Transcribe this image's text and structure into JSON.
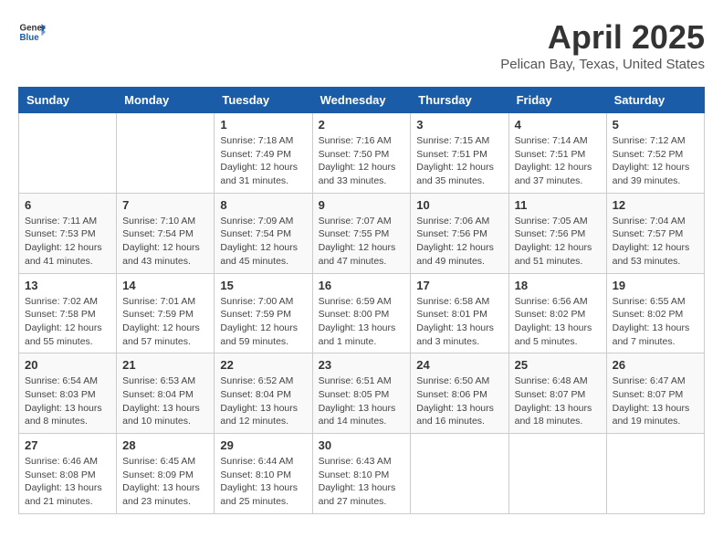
{
  "header": {
    "logo_general": "General",
    "logo_blue": "Blue",
    "title": "April 2025",
    "subtitle": "Pelican Bay, Texas, United States"
  },
  "columns": [
    "Sunday",
    "Monday",
    "Tuesday",
    "Wednesday",
    "Thursday",
    "Friday",
    "Saturday"
  ],
  "weeks": [
    [
      {
        "day": "",
        "info": ""
      },
      {
        "day": "",
        "info": ""
      },
      {
        "day": "1",
        "info": "Sunrise: 7:18 AM\nSunset: 7:49 PM\nDaylight: 12 hours and 31 minutes."
      },
      {
        "day": "2",
        "info": "Sunrise: 7:16 AM\nSunset: 7:50 PM\nDaylight: 12 hours and 33 minutes."
      },
      {
        "day": "3",
        "info": "Sunrise: 7:15 AM\nSunset: 7:51 PM\nDaylight: 12 hours and 35 minutes."
      },
      {
        "day": "4",
        "info": "Sunrise: 7:14 AM\nSunset: 7:51 PM\nDaylight: 12 hours and 37 minutes."
      },
      {
        "day": "5",
        "info": "Sunrise: 7:12 AM\nSunset: 7:52 PM\nDaylight: 12 hours and 39 minutes."
      }
    ],
    [
      {
        "day": "6",
        "info": "Sunrise: 7:11 AM\nSunset: 7:53 PM\nDaylight: 12 hours and 41 minutes."
      },
      {
        "day": "7",
        "info": "Sunrise: 7:10 AM\nSunset: 7:54 PM\nDaylight: 12 hours and 43 minutes."
      },
      {
        "day": "8",
        "info": "Sunrise: 7:09 AM\nSunset: 7:54 PM\nDaylight: 12 hours and 45 minutes."
      },
      {
        "day": "9",
        "info": "Sunrise: 7:07 AM\nSunset: 7:55 PM\nDaylight: 12 hours and 47 minutes."
      },
      {
        "day": "10",
        "info": "Sunrise: 7:06 AM\nSunset: 7:56 PM\nDaylight: 12 hours and 49 minutes."
      },
      {
        "day": "11",
        "info": "Sunrise: 7:05 AM\nSunset: 7:56 PM\nDaylight: 12 hours and 51 minutes."
      },
      {
        "day": "12",
        "info": "Sunrise: 7:04 AM\nSunset: 7:57 PM\nDaylight: 12 hours and 53 minutes."
      }
    ],
    [
      {
        "day": "13",
        "info": "Sunrise: 7:02 AM\nSunset: 7:58 PM\nDaylight: 12 hours and 55 minutes."
      },
      {
        "day": "14",
        "info": "Sunrise: 7:01 AM\nSunset: 7:59 PM\nDaylight: 12 hours and 57 minutes."
      },
      {
        "day": "15",
        "info": "Sunrise: 7:00 AM\nSunset: 7:59 PM\nDaylight: 12 hours and 59 minutes."
      },
      {
        "day": "16",
        "info": "Sunrise: 6:59 AM\nSunset: 8:00 PM\nDaylight: 13 hours and 1 minute."
      },
      {
        "day": "17",
        "info": "Sunrise: 6:58 AM\nSunset: 8:01 PM\nDaylight: 13 hours and 3 minutes."
      },
      {
        "day": "18",
        "info": "Sunrise: 6:56 AM\nSunset: 8:02 PM\nDaylight: 13 hours and 5 minutes."
      },
      {
        "day": "19",
        "info": "Sunrise: 6:55 AM\nSunset: 8:02 PM\nDaylight: 13 hours and 7 minutes."
      }
    ],
    [
      {
        "day": "20",
        "info": "Sunrise: 6:54 AM\nSunset: 8:03 PM\nDaylight: 13 hours and 8 minutes."
      },
      {
        "day": "21",
        "info": "Sunrise: 6:53 AM\nSunset: 8:04 PM\nDaylight: 13 hours and 10 minutes."
      },
      {
        "day": "22",
        "info": "Sunrise: 6:52 AM\nSunset: 8:04 PM\nDaylight: 13 hours and 12 minutes."
      },
      {
        "day": "23",
        "info": "Sunrise: 6:51 AM\nSunset: 8:05 PM\nDaylight: 13 hours and 14 minutes."
      },
      {
        "day": "24",
        "info": "Sunrise: 6:50 AM\nSunset: 8:06 PM\nDaylight: 13 hours and 16 minutes."
      },
      {
        "day": "25",
        "info": "Sunrise: 6:48 AM\nSunset: 8:07 PM\nDaylight: 13 hours and 18 minutes."
      },
      {
        "day": "26",
        "info": "Sunrise: 6:47 AM\nSunset: 8:07 PM\nDaylight: 13 hours and 19 minutes."
      }
    ],
    [
      {
        "day": "27",
        "info": "Sunrise: 6:46 AM\nSunset: 8:08 PM\nDaylight: 13 hours and 21 minutes."
      },
      {
        "day": "28",
        "info": "Sunrise: 6:45 AM\nSunset: 8:09 PM\nDaylight: 13 hours and 23 minutes."
      },
      {
        "day": "29",
        "info": "Sunrise: 6:44 AM\nSunset: 8:10 PM\nDaylight: 13 hours and 25 minutes."
      },
      {
        "day": "30",
        "info": "Sunrise: 6:43 AM\nSunset: 8:10 PM\nDaylight: 13 hours and 27 minutes."
      },
      {
        "day": "",
        "info": ""
      },
      {
        "day": "",
        "info": ""
      },
      {
        "day": "",
        "info": ""
      }
    ]
  ]
}
